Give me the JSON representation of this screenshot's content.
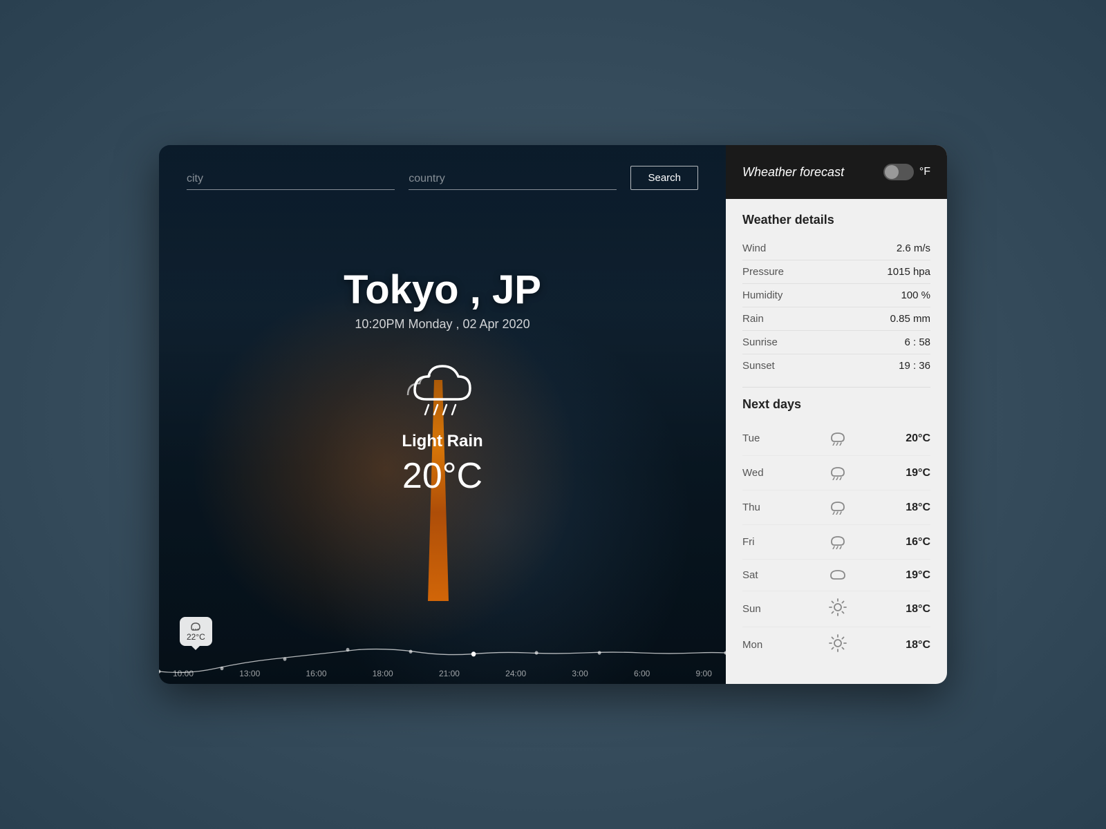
{
  "app": {
    "title": "Wheather forecast",
    "unit_label": "°F"
  },
  "search": {
    "city_placeholder": "city",
    "country_placeholder": "country",
    "button_label": "Search"
  },
  "weather": {
    "city": "Tokyo , JP",
    "datetime": "10:20PM  Monday , 02 Apr 2020",
    "description": "Light Rain",
    "temperature": "20°C",
    "temp_tooltip": "22°C"
  },
  "details": {
    "title": "Weather details",
    "rows": [
      {
        "label": "Wind",
        "value": "2.6 m/s"
      },
      {
        "label": "Pressure",
        "value": "1015 hpa"
      },
      {
        "label": "Humidity",
        "value": "100 %"
      },
      {
        "label": "Rain",
        "value": "0.85 mm"
      },
      {
        "label": "Sunrise",
        "value": "6 : 58"
      },
      {
        "label": "Sunset",
        "value": "19 : 36"
      }
    ]
  },
  "forecast": {
    "title": "Next days",
    "days": [
      {
        "day": "Tue",
        "icon": "rain",
        "temp": "20°C"
      },
      {
        "day": "Wed",
        "icon": "rain",
        "temp": "19°C"
      },
      {
        "day": "Thu",
        "icon": "rain",
        "temp": "18°C"
      },
      {
        "day": "Fri",
        "icon": "rain",
        "temp": "16°C"
      },
      {
        "day": "Sat",
        "icon": "cloud",
        "temp": "19°C"
      },
      {
        "day": "Sun",
        "icon": "sun",
        "temp": "18°C"
      },
      {
        "day": "Mon",
        "icon": "sun",
        "temp": "18°C"
      }
    ]
  },
  "timeline": {
    "labels": [
      "10:00",
      "13:00",
      "16:00",
      "18:00",
      "21:00",
      "24:00",
      "3:00",
      "6:00",
      "9:00"
    ]
  }
}
